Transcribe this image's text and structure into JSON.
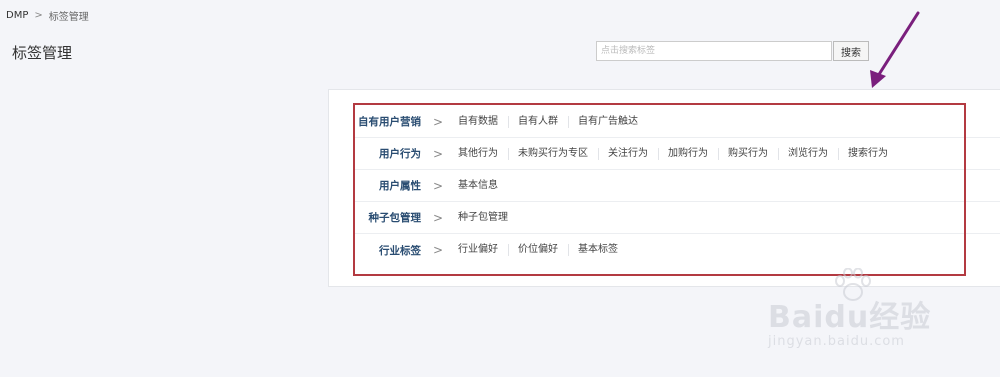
{
  "breadcrumb": {
    "root": "DMP",
    "separator": ">",
    "current": "标签管理"
  },
  "page": {
    "title": "标签管理"
  },
  "search": {
    "placeholder": "点击搜索标签",
    "value": "",
    "button_label": "搜索"
  },
  "tag_categories": [
    {
      "label": "自有用户营销",
      "separator": ">",
      "items": [
        "自有数据",
        "自有人群",
        "自有广告触达"
      ]
    },
    {
      "label": "用户行为",
      "separator": ">",
      "items": [
        "其他行为",
        "未购买行为专区",
        "关注行为",
        "加购行为",
        "购买行为",
        "浏览行为",
        "搜索行为"
      ]
    },
    {
      "label": "用户属性",
      "separator": ">",
      "items": [
        "基本信息"
      ]
    },
    {
      "label": "种子包管理",
      "separator": ">",
      "items": [
        "种子包管理"
      ]
    },
    {
      "label": "行业标签",
      "separator": ">",
      "items": [
        "行业偏好",
        "价位偏好",
        "基本标签"
      ]
    }
  ],
  "watermark": {
    "brand": "Baidu经验",
    "url": "jingyan.baidu.com"
  },
  "colors": {
    "category_label": "#2a4d72",
    "highlight_border": "#b33a41",
    "annotation_arrow": "#7a1f7d",
    "page_background": "#f4f5f9"
  }
}
